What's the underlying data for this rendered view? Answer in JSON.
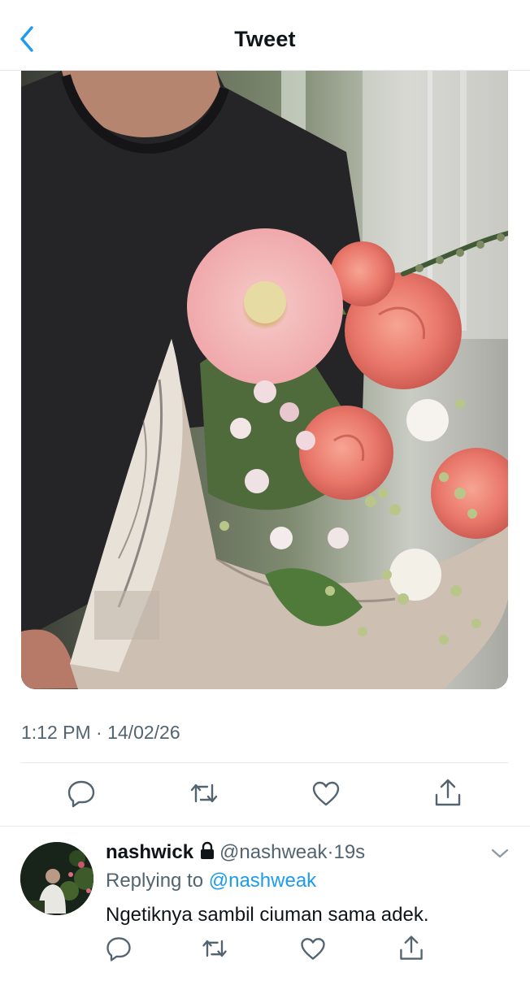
{
  "header": {
    "title": "Tweet",
    "back_icon": "chevron-left-icon",
    "accent": "#1d9bf0"
  },
  "tweet": {
    "media_description": "photo",
    "timestamp": "1:12 PM · 14/02/26",
    "actions": [
      "reply-icon",
      "retweet-icon",
      "like-icon",
      "share-icon"
    ]
  },
  "reply": {
    "name": "nashwick",
    "handle": "@nashweak",
    "separator": "·",
    "time": "19s",
    "replying_prefix": "Replying to ",
    "replying_to": "@nashweak",
    "text": "Ngetiknya sambil ciuman sama adek.",
    "actions": [
      "reply-icon",
      "retweet-icon",
      "like-icon",
      "share-icon"
    ]
  }
}
